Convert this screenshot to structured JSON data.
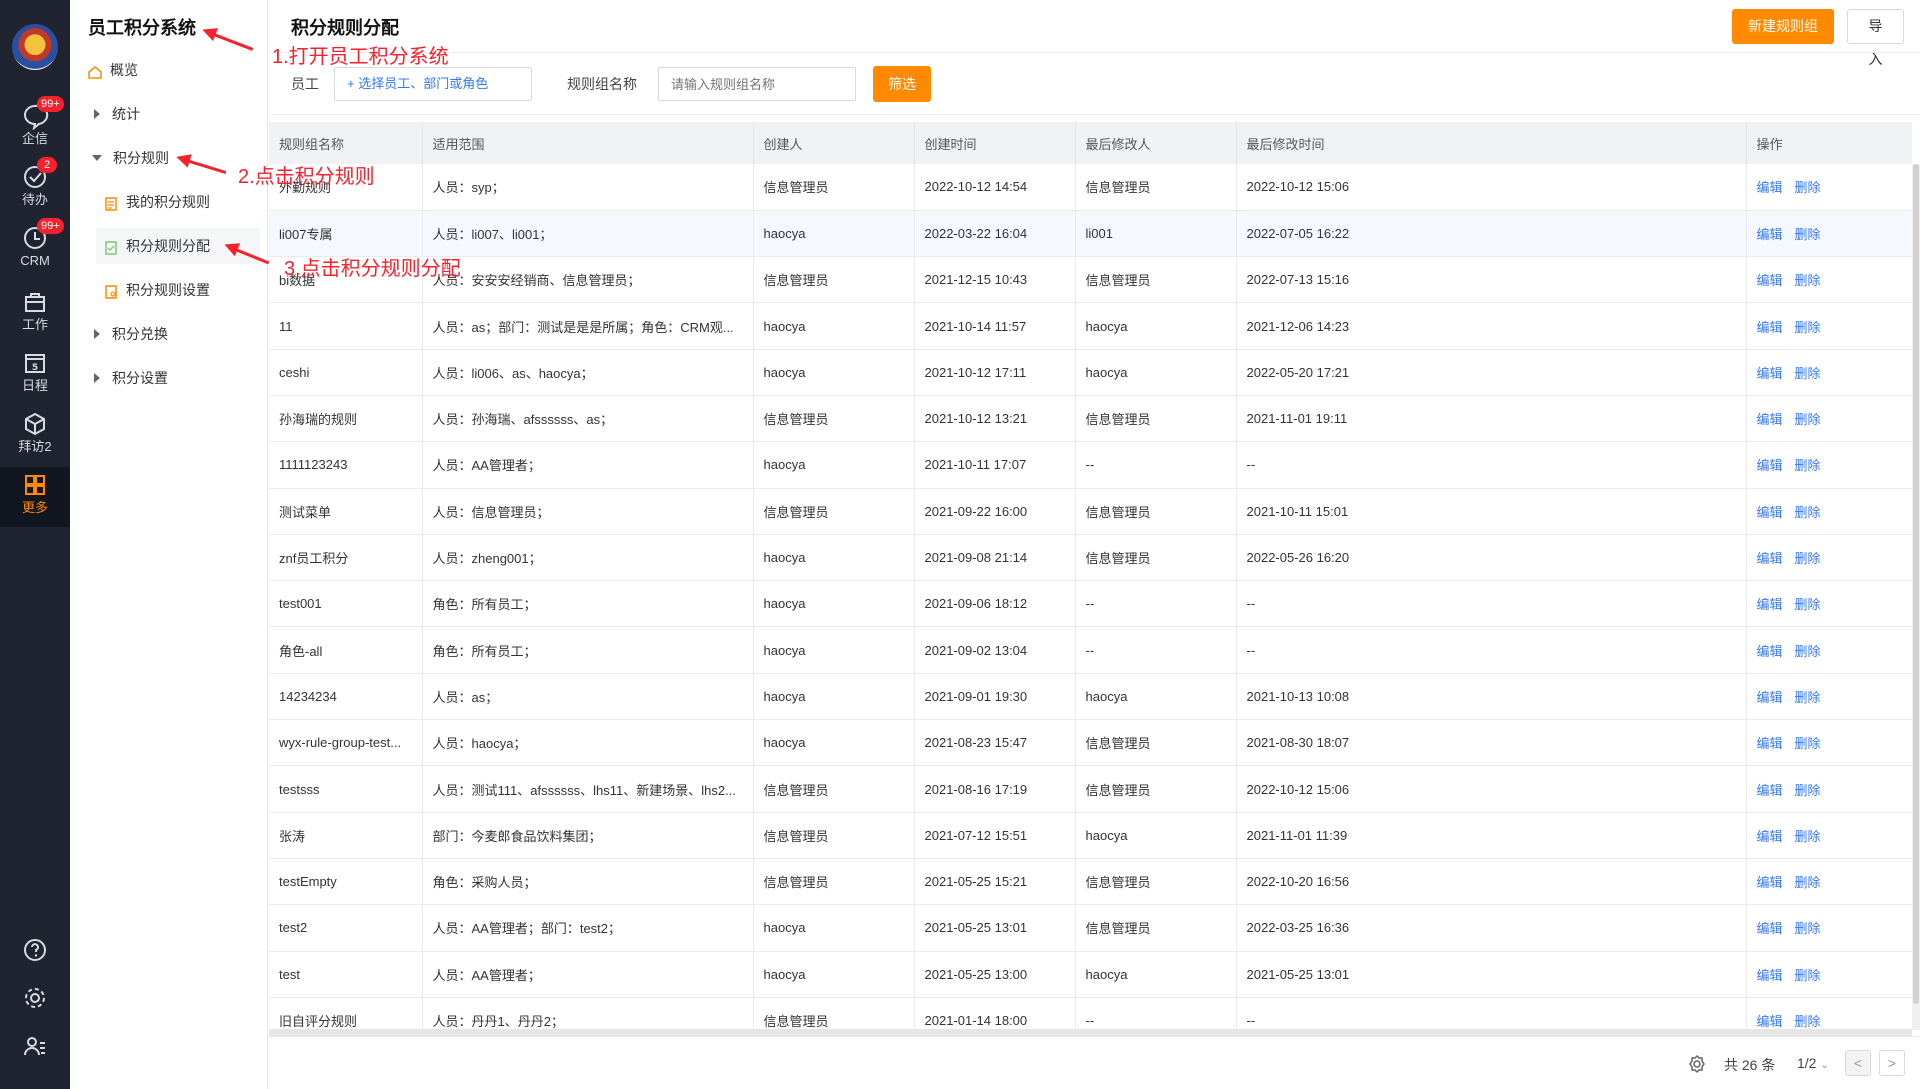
{
  "rail": {
    "items": [
      {
        "label": "企信",
        "badge": "99+"
      },
      {
        "label": "待办",
        "badge": "2"
      },
      {
        "label": "CRM",
        "badge": "99+"
      },
      {
        "label": "工作",
        "badge": ""
      },
      {
        "label": "日程",
        "badge": ""
      },
      {
        "label": "拜访2",
        "badge": ""
      },
      {
        "label": "更多",
        "badge": ""
      }
    ],
    "calendar_day": "5",
    "active_color": "#ff8a00"
  },
  "menu": {
    "title": "员工积分系统",
    "items": {
      "overview": "概览",
      "stats": "统计",
      "rules": "积分规则",
      "my_rules": "我的积分规则",
      "rule_assign": "积分规则分配",
      "rule_settings": "积分规则设置",
      "exchange": "积分兑换",
      "settings": "积分设置"
    }
  },
  "annotations": {
    "step1": "1.打开员工积分系统",
    "step2": "2.点击积分规则",
    "step3": "3.点击积分规则分配"
  },
  "header": {
    "title": "积分规则分配",
    "new_button": "新建规则组",
    "import_button": "导入"
  },
  "filter": {
    "employee_label": "员工",
    "employee_value": "+ 选择员工、部门或角色",
    "group_label": "规则组名称",
    "group_placeholder": "请输入规则组名称",
    "filter_button": "筛选"
  },
  "table": {
    "columns": [
      "规则组名称",
      "适用范围",
      "创建人",
      "创建时间",
      "最后修改人",
      "最后修改时间",
      "操作"
    ],
    "edit_label": "编辑",
    "delete_label": "删除",
    "rows": [
      [
        "外勤规则",
        "人员：syp；",
        "信息管理员",
        "2022-10-12 14:54",
        "信息管理员",
        "2022-10-12 15:06"
      ],
      [
        "li007专属",
        "人员：li007、li001；",
        "haocya",
        "2022-03-22 16:04",
        "li001",
        "2022-07-05 16:22"
      ],
      [
        "bi数据",
        "人员：安安安经销商、信息管理员；",
        "信息管理员",
        "2021-12-15 10:43",
        "信息管理员",
        "2022-07-13 15:16"
      ],
      [
        "11",
        "人员：as；部门：测试是是是所属；角色：CRM观...",
        "haocya",
        "2021-10-14 11:57",
        "haocya",
        "2021-12-06 14:23"
      ],
      [
        "ceshi",
        "人员：li006、as、haocya；",
        "haocya",
        "2021-10-12 17:11",
        "haocya",
        "2022-05-20 17:21"
      ],
      [
        "孙海瑞的规则",
        "人员：孙海瑞、afssssss、as；",
        "信息管理员",
        "2021-10-12 13:21",
        "信息管理员",
        "2021-11-01 19:11"
      ],
      [
        "1111123243",
        "人员：AA管理者；",
        "haocya",
        "2021-10-11 17:07",
        "--",
        "--"
      ],
      [
        "测试菜单",
        "人员：信息管理员；",
        "信息管理员",
        "2021-09-22 16:00",
        "信息管理员",
        "2021-10-11 15:01"
      ],
      [
        "znf员工积分",
        "人员：zheng001；",
        "haocya",
        "2021-09-08 21:14",
        "信息管理员",
        "2022-05-26 16:20"
      ],
      [
        "test001",
        "角色：所有员工；",
        "haocya",
        "2021-09-06 18:12",
        "--",
        "--"
      ],
      [
        "角色-all",
        "角色：所有员工；",
        "haocya",
        "2021-09-02 13:04",
        "--",
        "--"
      ],
      [
        "14234234",
        "人员：as；",
        "haocya",
        "2021-09-01 19:30",
        "haocya",
        "2021-10-13 10:08"
      ],
      [
        "wyx-rule-group-test...",
        "人员：haocya；",
        "haocya",
        "2021-08-23 15:47",
        "信息管理员",
        "2021-08-30 18:07"
      ],
      [
        "testsss",
        "人员：测试111、afssssss、lhs11、新建场景、lhs2...",
        "信息管理员",
        "2021-08-16 17:19",
        "信息管理员",
        "2022-10-12 15:06"
      ],
      [
        "张涛",
        "部门：今麦郎食品饮料集团；",
        "信息管理员",
        "2021-07-12 15:51",
        "haocya",
        "2021-11-01 11:39"
      ],
      [
        "testEmpty",
        "角色：采购人员；",
        "信息管理员",
        "2021-05-25 15:21",
        "信息管理员",
        "2022-10-20 16:56"
      ],
      [
        "test2",
        "人员：AA管理者；部门：test2；",
        "haocya",
        "2021-05-25 13:01",
        "信息管理员",
        "2022-03-25 16:36"
      ],
      [
        "test",
        "人员：AA管理者；",
        "haocya",
        "2021-05-25 13:00",
        "haocya",
        "2021-05-25 13:01"
      ],
      [
        "旧自评分规则",
        "人员：丹丹1、丹丹2；",
        "信息管理员",
        "2021-01-14 18:00",
        "--",
        "--"
      ]
    ]
  },
  "footer": {
    "total": "共 26 条",
    "page": "1/2",
    "prev": "<",
    "next": ">"
  }
}
